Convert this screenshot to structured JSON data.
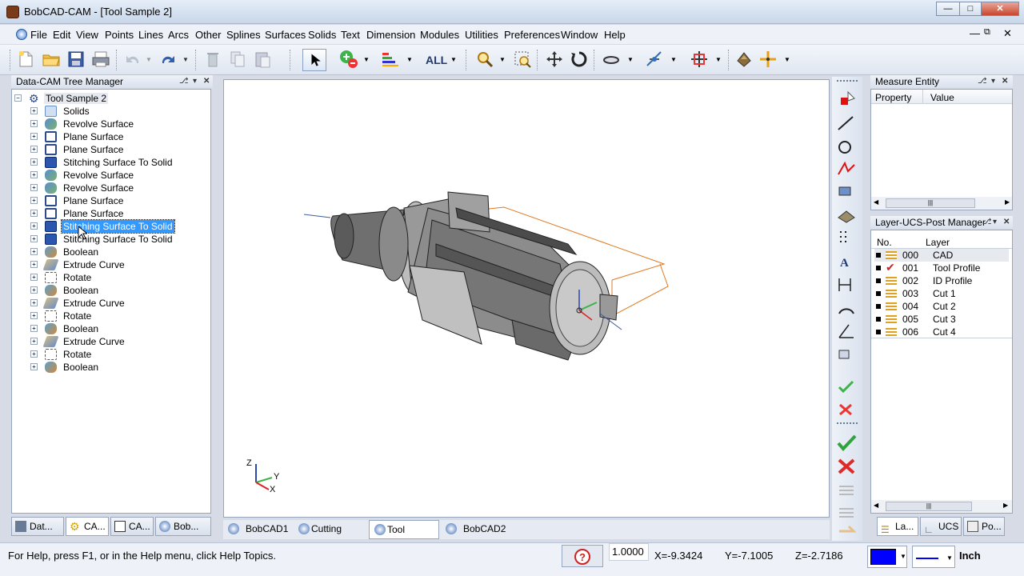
{
  "window": {
    "title": "BobCAD-CAM - [Tool Sample 2]"
  },
  "menu": [
    "File",
    "Edit",
    "View",
    "Points",
    "Lines",
    "Arcs",
    "Other",
    "Splines",
    "Surfaces",
    "Solids",
    "Text",
    "Dimension",
    "Modules",
    "Utilities",
    "Preferences",
    "Window",
    "Help"
  ],
  "toolbar": {
    "all_label": "ALL"
  },
  "tree": {
    "title": "Data-CAM Tree Manager",
    "root": "Tool Sample 2",
    "items": [
      {
        "label": "Solids",
        "icon": "folder-icon"
      },
      {
        "label": "Revolve Surface",
        "icon": "revolve-icon"
      },
      {
        "label": "Plane Surface",
        "icon": "plane-icon"
      },
      {
        "label": "Plane Surface",
        "icon": "plane-icon"
      },
      {
        "label": "Stitching Surface To Solid",
        "icon": "stitch-icon"
      },
      {
        "label": "Revolve Surface",
        "icon": "revolve-icon"
      },
      {
        "label": "Revolve Surface",
        "icon": "revolve-icon"
      },
      {
        "label": "Plane Surface",
        "icon": "plane-icon"
      },
      {
        "label": "Plane Surface",
        "icon": "plane-icon"
      },
      {
        "label": "Stitching Surface To Solid",
        "icon": "stitch-icon"
      },
      {
        "label": "Stitching Surface To Solid",
        "icon": "stitch-icon"
      },
      {
        "label": "Boolean",
        "icon": "boolean-icon"
      },
      {
        "label": "Extrude Curve",
        "icon": "extrude-icon"
      },
      {
        "label": "Rotate",
        "icon": "rotate-icon"
      },
      {
        "label": "Boolean",
        "icon": "boolean-icon"
      },
      {
        "label": "Extrude Curve",
        "icon": "extrude-icon"
      },
      {
        "label": "Rotate",
        "icon": "rotate-icon"
      },
      {
        "label": "Boolean",
        "icon": "boolean-icon"
      },
      {
        "label": "Extrude Curve",
        "icon": "extrude-icon"
      },
      {
        "label": "Rotate",
        "icon": "rotate-icon"
      },
      {
        "label": "Boolean",
        "icon": "boolean-icon"
      }
    ],
    "selected_index": 9
  },
  "left_tabs": [
    "Dat...",
    "CA...",
    "CA...",
    "Bob..."
  ],
  "doc_tabs": [
    "BobCAD1",
    "Cutting Tool...",
    "Tool Samp...",
    "BobCAD2"
  ],
  "measure": {
    "title": "Measure Entity",
    "col_property": "Property",
    "col_value": "Value"
  },
  "layers": {
    "title": "Layer-UCS-Post Manager",
    "col_no": "No.",
    "col_layer": "Layer",
    "rows": [
      {
        "no": "000",
        "name": "CAD"
      },
      {
        "no": "001",
        "name": "Tool Profile"
      },
      {
        "no": "002",
        "name": "ID Profile"
      },
      {
        "no": "003",
        "name": "Cut 1"
      },
      {
        "no": "004",
        "name": "Cut 2"
      },
      {
        "no": "005",
        "name": "Cut 3"
      },
      {
        "no": "006",
        "name": "Cut 4"
      }
    ]
  },
  "right_tabs": [
    "La...",
    "UCS",
    "Po..."
  ],
  "axes": {
    "z": "Z",
    "y": "Y",
    "x": "X"
  },
  "status": {
    "help": "For Help, press F1, or in the Help menu, click Help Topics.",
    "value": "1.0000",
    "x": "X=-9.3424",
    "y": "Y=-7.1005",
    "z": "Z=-2.7186",
    "units": "Inch",
    "color": "#0000ff"
  }
}
